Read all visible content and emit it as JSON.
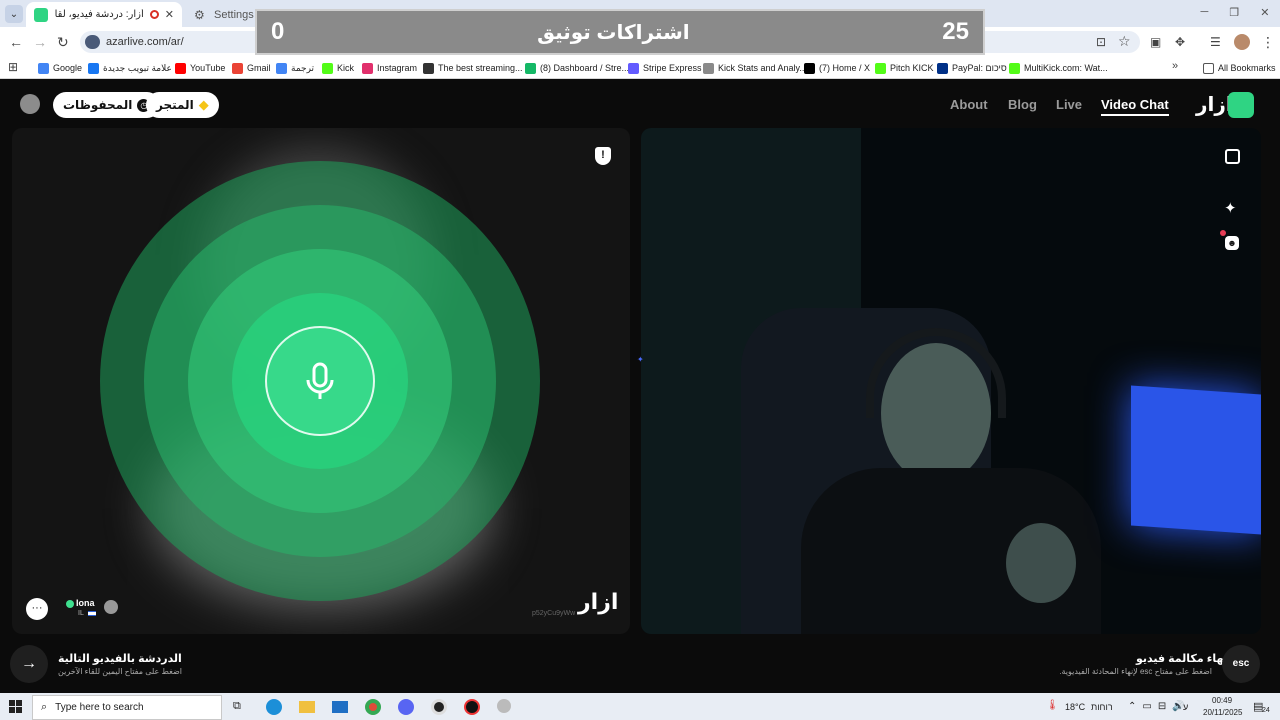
{
  "browser": {
    "tabs": [
      {
        "title": "أزار: دردشة فيديو، لقاء الأصدقاء"
      },
      {
        "title": "Settings - Camera"
      }
    ],
    "new_tab": "+",
    "url": "azarlive.com/ar/",
    "bookmarks": [
      {
        "label": "Google",
        "color": "#4285f4"
      },
      {
        "label": "علامة تبويب جديدة",
        "color": "#1877f2"
      },
      {
        "label": "YouTube",
        "color": "#ff0000"
      },
      {
        "label": "Gmail",
        "color": "#ea4335"
      },
      {
        "label": "ترجمة",
        "color": "#4285f4"
      },
      {
        "label": "Kick",
        "color": "#53fc18"
      },
      {
        "label": "Instagram",
        "color": "#e1306c"
      },
      {
        "label": "The best streaming...",
        "color": "#333333"
      },
      {
        "label": "(8) Dashboard / Stre...",
        "color": "#14b866"
      },
      {
        "label": "Stripe Express",
        "color": "#635bff"
      },
      {
        "label": "Kick Stats and Analy...",
        "color": "#8a8a8a"
      },
      {
        "label": "(7) Home / X",
        "color": "#000000"
      },
      {
        "label": "Pitch KICK",
        "color": "#53fc18"
      },
      {
        "label": "PayPal: סיכום",
        "color": "#003087"
      },
      {
        "label": "MultiKick.com: Wat...",
        "color": "#53fc18"
      }
    ],
    "all_bookmarks": "All Bookmarks"
  },
  "overlay": {
    "left_count": "0",
    "title": "اشتراكات توثيق",
    "right_count": "25"
  },
  "header": {
    "saved": "المحفوظات",
    "shop": "المتجر",
    "nav": [
      "About",
      "Blog",
      "Live",
      "Video Chat"
    ],
    "logo": "ازار"
  },
  "remote": {
    "username": "Iona",
    "country": "IL",
    "watermark": "ازار",
    "code": "p52yCu9yWw"
  },
  "footer": {
    "next_title": "الدردشة بالفيديو التالية",
    "next_sub": "اضغط على مفتاح اليمين للقاء الآخرين",
    "end_title": "إنهاء مكالمة فيديو",
    "end_sub": "اضغط على مفتاح esc لإنهاء المحادثة الفيديوية.",
    "esc": "esc"
  },
  "taskbar": {
    "search": "Type here to search",
    "temp": "18°C",
    "weather": "רוחות",
    "lang": "ע",
    "time": "00:49",
    "date": "20/11/2025",
    "notifications": "24"
  },
  "colors": {
    "accent_green": "#3ee08f",
    "brand_green": "#2fd483"
  }
}
